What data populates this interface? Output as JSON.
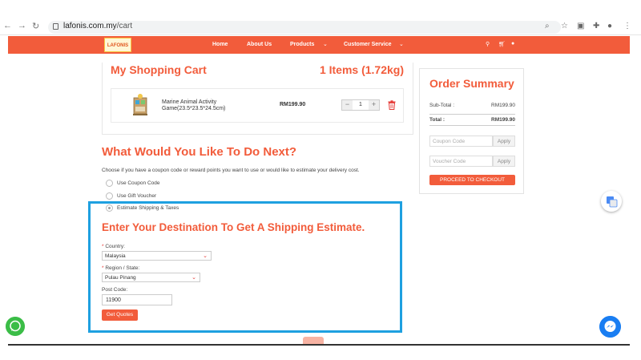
{
  "browser": {
    "url_domain": "lafonis.com.my",
    "url_path": "/cart"
  },
  "header": {
    "logo_text": "LAFONIS",
    "menu": [
      {
        "label": "Home"
      },
      {
        "label": "About Us"
      },
      {
        "label": "Products"
      },
      {
        "label": "Customer Service"
      }
    ],
    "accent_color": "#f25c3b"
  },
  "cart": {
    "title": "My Shopping Cart",
    "count": "1 Items (1.72kg)",
    "item": {
      "name": "Marine Animal Activity Game(23.5*23.5*24.5cm)",
      "price": "RM199.90",
      "quantity": "1",
      "minus": "−",
      "plus": "+"
    }
  },
  "summary": {
    "title": "Order Summary",
    "subtotal_label": "Sub-Total :",
    "subtotal_value": "RM199.90",
    "total_label": "Total :",
    "total_value": "RM199.90",
    "coupon_placeholder": "Coupon Code",
    "voucher_placeholder": "Voucher Code",
    "apply_label": "Apply",
    "checkout_label": "PROCEED TO CHECKOUT"
  },
  "next": {
    "title": "What Would You Like To Do Next?",
    "description": "Choose if you have a coupon code or reward points you want to use or would like to estimate your delivery cost.",
    "options": [
      {
        "label": "Use Coupon Code",
        "selected": false
      },
      {
        "label": "Use Gift Voucher",
        "selected": false
      },
      {
        "label": "Estimate Shipping & Taxes",
        "selected": true
      }
    ]
  },
  "shipping": {
    "title": "Enter Your Destination To Get A Shipping Estimate.",
    "required_mark": "*",
    "country_label": "Country:",
    "country_value": "Malaysia",
    "region_label": "Region / State:",
    "region_value": "Pulau Pinang",
    "postcode_label": "Post Code:",
    "postcode_value": "11900",
    "button_label": "Get Quotes"
  }
}
